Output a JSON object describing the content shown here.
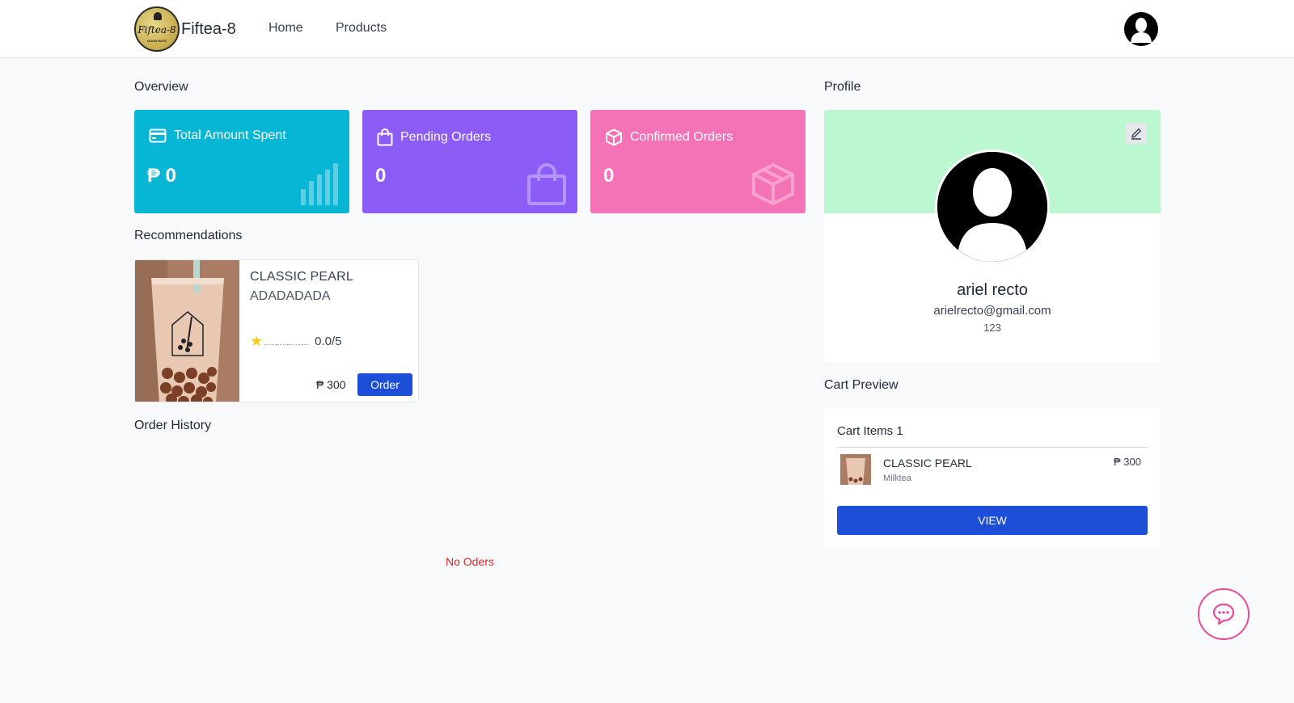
{
  "navbar": {
    "brand": "Fiftea-8",
    "logo_text": "Fiftea-8",
    "logo_subtext": "GOOD EATS",
    "links": [
      {
        "label": "Home"
      },
      {
        "label": "Products"
      }
    ],
    "avatar_icon": "user-silhouette-icon"
  },
  "overview": {
    "title": "Overview",
    "cards": [
      {
        "label": "Total Amount Spent",
        "value": "₱ 0",
        "icon": "credit-card-icon",
        "deco_icon": "bar-chart-icon",
        "color": "#06b6d4"
      },
      {
        "label": "Pending Orders",
        "value": "0",
        "icon": "shopping-bag-icon",
        "deco_icon": "shopping-bag-icon",
        "color": "#8b5cf6"
      },
      {
        "label": "Confirmed Orders",
        "value": "0",
        "icon": "box-icon",
        "deco_icon": "box-icon",
        "color": "#f472b6"
      }
    ]
  },
  "recommendations": {
    "title": "Recommendations",
    "items": [
      {
        "name": "CLASSIC PEARL",
        "description": "ADADADADA",
        "rating": "0.0/5",
        "stars_filled": 1,
        "stars_total": 5,
        "price": "₱ 300",
        "order_label": "Order"
      }
    ]
  },
  "order_history": {
    "title": "Order History",
    "empty_text": "No Oders"
  },
  "profile": {
    "title": "Profile",
    "name": "ariel recto",
    "email": "arielrecto@gmail.com",
    "phone": "123",
    "banner_color": "#bbf7d0",
    "edit_icon": "pencil-icon"
  },
  "cart": {
    "title": "Cart Preview",
    "items_label": "Cart Items 1",
    "items": [
      {
        "name": "CLASSIC PEARL",
        "category": "Milktea",
        "price": "₱ 300"
      }
    ],
    "view_label": "VIEW"
  },
  "chat": {
    "icon": "chat-bubble-icon",
    "color": "#ec4899"
  },
  "colors": {
    "primary": "#1d4ed8",
    "error": "#dc2626"
  }
}
